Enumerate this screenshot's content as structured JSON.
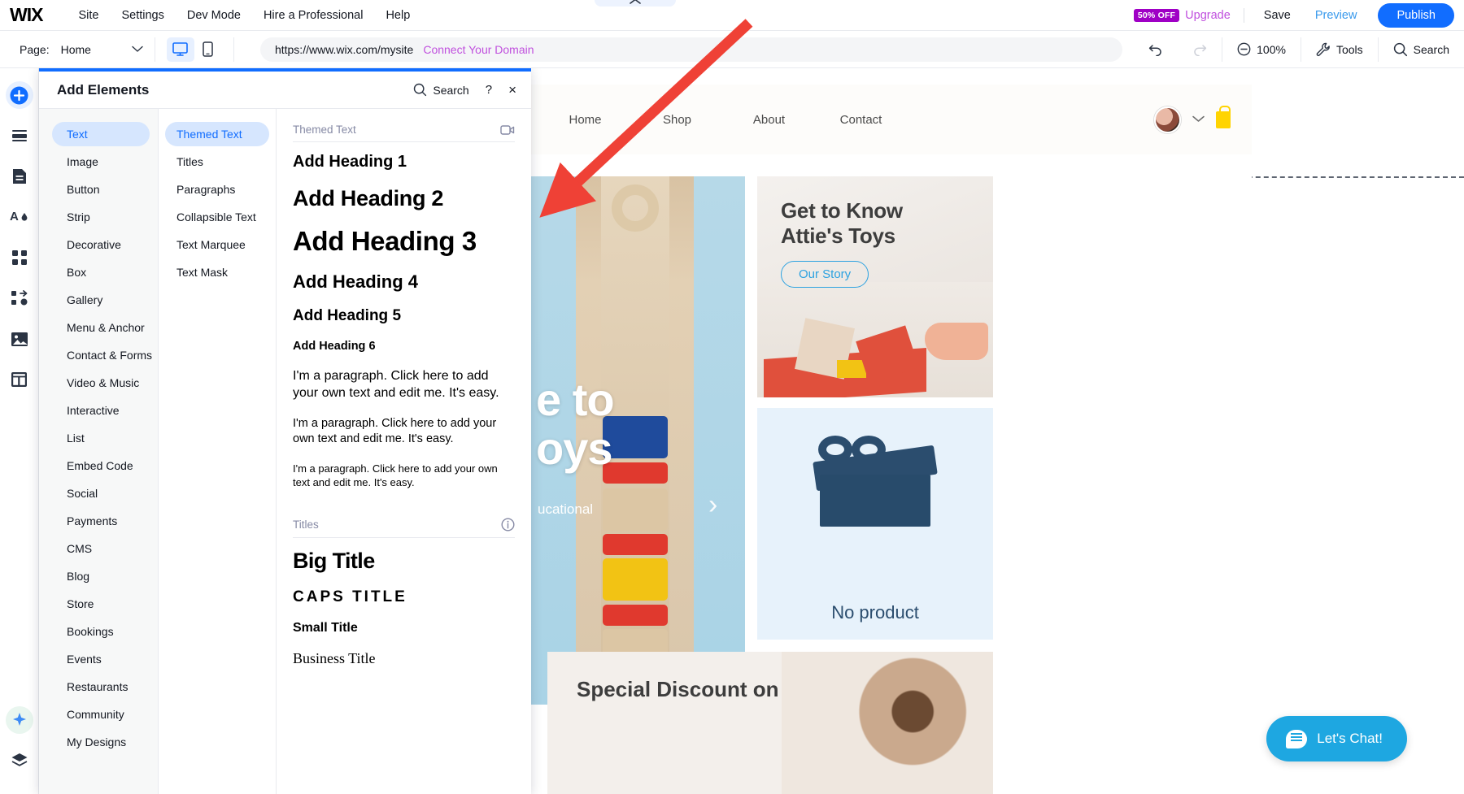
{
  "topbar": {
    "logo": "WIX",
    "menu": [
      {
        "label": "Site"
      },
      {
        "label": "Settings"
      },
      {
        "label": "Dev Mode"
      },
      {
        "label": "Hire a Professional"
      },
      {
        "label": "Help"
      }
    ],
    "promo_badge": "50% OFF",
    "upgrade_label": "Upgrade",
    "save_label": "Save",
    "preview_label": "Preview",
    "publish_label": "Publish"
  },
  "subbar": {
    "page_label": "Page:",
    "page_value": "Home",
    "url": "https://www.wix.com/mysite",
    "connect_domain": "Connect Your Domain",
    "zoom_label": "100%",
    "tools_label": "Tools",
    "search_label": "Search"
  },
  "rail": {
    "items": [
      {
        "name": "add-element-icon"
      },
      {
        "name": "site-sections-icon"
      },
      {
        "name": "pages-icon"
      },
      {
        "name": "theme-icon"
      },
      {
        "name": "apps-icon"
      },
      {
        "name": "interactions-icon"
      },
      {
        "name": "media-icon"
      },
      {
        "name": "cms-icon"
      }
    ],
    "bottom": [
      {
        "name": "ai-sparkle-icon"
      },
      {
        "name": "layers-icon"
      }
    ]
  },
  "panel": {
    "title": "Add Elements",
    "search_label": "Search",
    "help_label": "?",
    "close_label": "×",
    "categories": [
      {
        "label": "Text",
        "active": true
      },
      {
        "label": "Image",
        "active": false
      },
      {
        "label": "Button",
        "active": false
      },
      {
        "label": "Strip",
        "active": false
      },
      {
        "label": "Decorative",
        "active": false
      },
      {
        "label": "Box",
        "active": false
      },
      {
        "label": "Gallery",
        "active": false
      },
      {
        "label": "Menu & Anchor",
        "active": false
      },
      {
        "label": "Contact & Forms",
        "active": false
      },
      {
        "label": "Video & Music",
        "active": false
      },
      {
        "label": "Interactive",
        "active": false
      },
      {
        "label": "List",
        "active": false
      },
      {
        "label": "Embed Code",
        "active": false
      },
      {
        "label": "Social",
        "active": false
      },
      {
        "label": "Payments",
        "active": false
      },
      {
        "label": "CMS",
        "active": false
      },
      {
        "label": "Blog",
        "active": false
      },
      {
        "label": "Store",
        "active": false
      },
      {
        "label": "Bookings",
        "active": false
      },
      {
        "label": "Events",
        "active": false
      },
      {
        "label": "Restaurants",
        "active": false
      },
      {
        "label": "Community",
        "active": false
      },
      {
        "label": "My Designs",
        "active": false
      }
    ],
    "subcategories": [
      {
        "label": "Themed Text",
        "active": true
      },
      {
        "label": "Titles",
        "active": false
      },
      {
        "label": "Paragraphs",
        "active": false
      },
      {
        "label": "Collapsible Text",
        "active": false
      },
      {
        "label": "Text Marquee",
        "active": false
      },
      {
        "label": "Text Mask",
        "active": false
      }
    ],
    "sections": [
      {
        "title": "Themed Text",
        "icon": "video-tutorial-icon",
        "tiles": [
          {
            "text": "Add Heading 1"
          },
          {
            "text": "Add Heading 2"
          },
          {
            "text": "Add Heading 3"
          },
          {
            "text": "Add Heading 4"
          },
          {
            "text": "Add Heading 5"
          },
          {
            "text": "Add Heading 6"
          },
          {
            "text": "I'm a paragraph. Click here to add your own text and edit me. It's easy."
          },
          {
            "text": "I'm a paragraph. Click here to add your own text and edit me. It's easy."
          },
          {
            "text": "I'm a paragraph. Click here to add your own text and edit me. It's easy."
          }
        ]
      },
      {
        "title": "Titles",
        "icon": "info-icon",
        "tiles": [
          {
            "text": "Big Title"
          },
          {
            "text": "CAPS TITLE"
          },
          {
            "text": "Small Title"
          },
          {
            "text": "Business Title"
          }
        ]
      }
    ]
  },
  "site": {
    "nav": [
      {
        "label": "Home"
      },
      {
        "label": "Shop"
      },
      {
        "label": "About"
      },
      {
        "label": "Contact"
      }
    ],
    "hero": {
      "title_line1": "e to",
      "title_line2": "oys",
      "subtitle": "ucational"
    },
    "attie_card": {
      "title": "Get to Know Attie's Toys",
      "button": "Our Story"
    },
    "no_product_card": {
      "text": "No product"
    },
    "discount_card": {
      "title": "Special Discount on"
    },
    "chat": {
      "label": "Let's Chat!"
    }
  },
  "annotation": {
    "arrow_color": "#ef4136"
  }
}
